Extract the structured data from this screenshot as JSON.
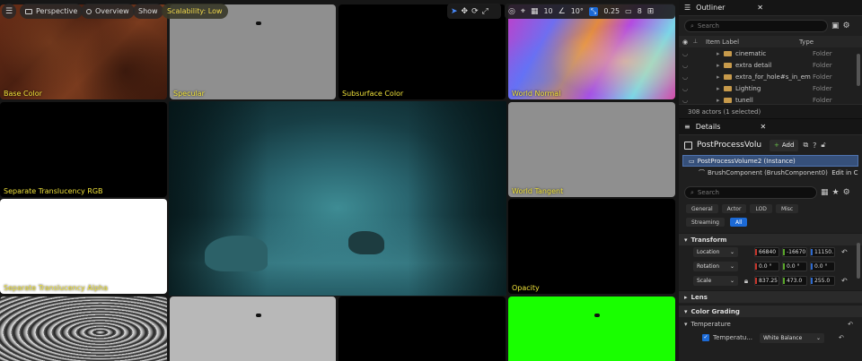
{
  "viewport": {
    "toolbar": {
      "perspective": "Perspective",
      "overview": "Overview",
      "show": "Show",
      "scalability": "Scalability: Low",
      "grid_snap": "10",
      "angle_snap": "10°",
      "scale_snap": "0.25",
      "camera_speed": "8"
    },
    "tiles": {
      "base_color": "Base Color",
      "specular": "Specular",
      "subsurface_color": "Subsurface Color",
      "world_normal": "World Normal",
      "separate_translucency_rgb": "Separate Translucency RGB",
      "world_tangent": "World Tangent",
      "separate_translucency_alpha": "Separate Translucency Alpha",
      "opacity": "Opacity"
    }
  },
  "outliner": {
    "tab_title": "Outliner",
    "search_placeholder": "Search",
    "col_item_label": "Item Label",
    "col_type": "Type",
    "items": [
      {
        "label": "cinematic",
        "type": "Folder"
      },
      {
        "label": "extra detail",
        "type": "Folder"
      },
      {
        "label": "extra_for_hole#s_in_em",
        "type": "Folder"
      },
      {
        "label": "Lighting",
        "type": "Folder"
      },
      {
        "label": "tunell",
        "type": "Folder"
      }
    ],
    "status": "308 actors (1 selected)"
  },
  "details": {
    "tab_title": "Details",
    "actor_name": "PostProcessVolu",
    "add_label": "Add",
    "instance_row": "PostProcessVolume2 (Instance)",
    "component_row": "BrushComponent (BrushComponent0)",
    "edit_link": "Edit in C",
    "search_placeholder": "Search",
    "filters": [
      "General",
      "Actor",
      "LOD",
      "Misc"
    ],
    "filters2": [
      "Streaming",
      "All"
    ],
    "transform": {
      "title": "Transform",
      "location_label": "Location",
      "location": [
        "66840",
        "-16670",
        "11150."
      ],
      "rotation_label": "Rotation",
      "rotation": [
        "0.0 °",
        "0.0 °",
        "0.0 °"
      ],
      "scale_label": "Scale",
      "scale": [
        "837.25",
        "473.0",
        "255.0"
      ]
    },
    "lens": "Lens",
    "color_grading": "Color Grading",
    "temperature": "Temperature",
    "temperature_prop": "Temperatu...",
    "white_balance": "White Balance"
  },
  "colors": {
    "accent_blue": "#1c6ad6",
    "label_yellow": "#f0e23a",
    "green_tile": "#19ff00"
  }
}
